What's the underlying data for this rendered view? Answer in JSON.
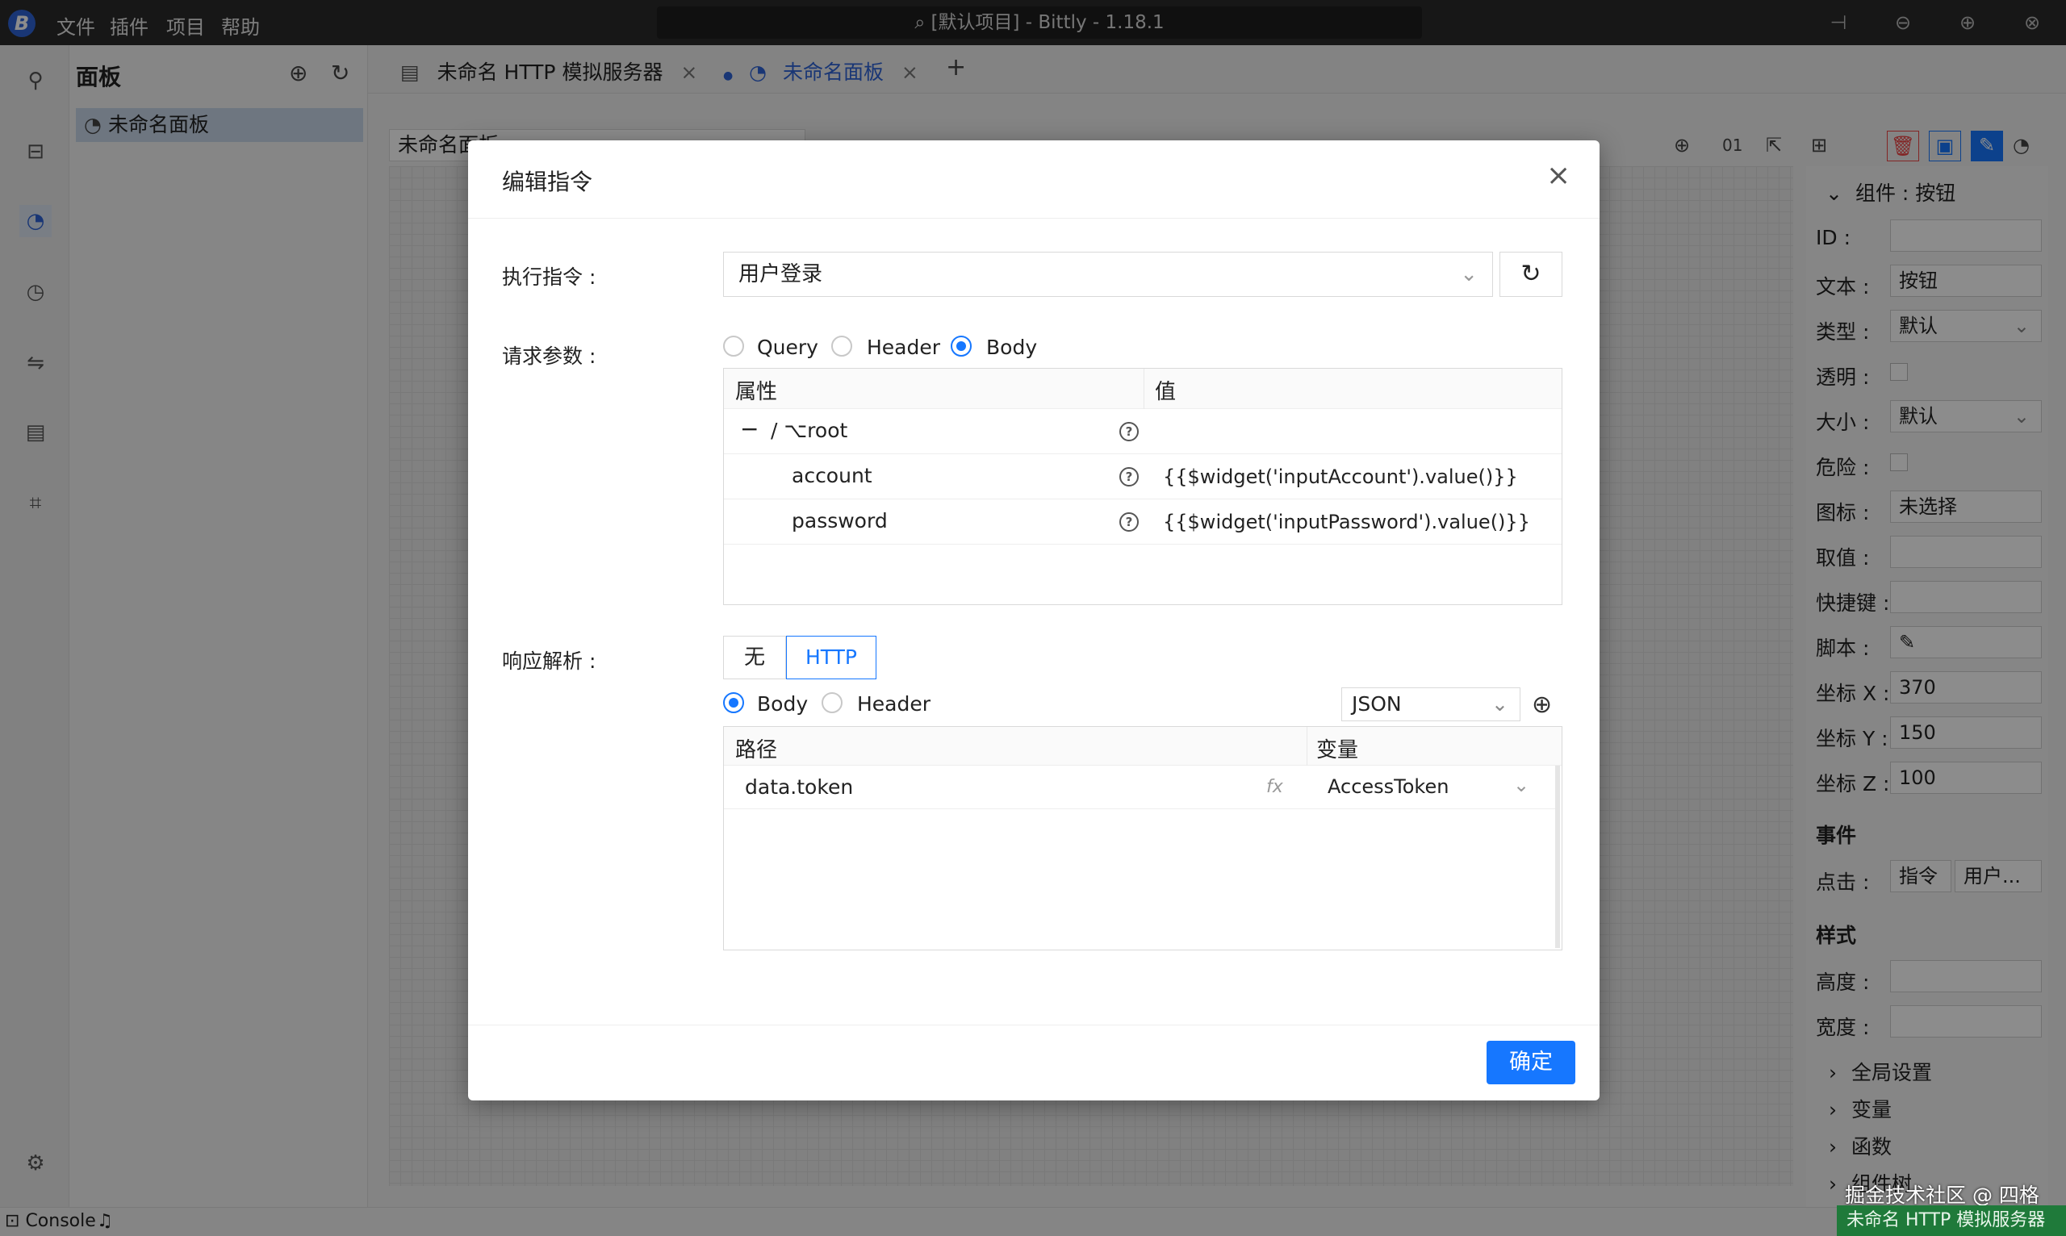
{
  "titlebar": {
    "menu": [
      "文件",
      "插件",
      "项目",
      "帮助"
    ],
    "search_text": "[默认项目] - Bittly - 1.18.1"
  },
  "sidebar": {
    "title": "面板",
    "items": [
      {
        "label": "未命名面板"
      }
    ]
  },
  "tabs": [
    {
      "label": "未命名 HTTP 模拟服务器"
    },
    {
      "label": "未命名面板"
    }
  ],
  "canvas": {
    "panel_name": "未命名面板"
  },
  "toolbar": {
    "code_btn": "01"
  },
  "props": {
    "section": "组件 : 按钮",
    "fields": {
      "id_label": "ID :",
      "id_value": "",
      "text_label": "文本 :",
      "text_value": "按钮",
      "type_label": "类型 :",
      "type_value": "默认",
      "transparent_label": "透明 :",
      "size_label": "大小 :",
      "size_value": "默认",
      "danger_label": "危险 :",
      "icon_label": "图标 :",
      "icon_value": "未选择",
      "value_label": "取值 :",
      "shortcut_label": "快捷键 :",
      "script_label": "脚本 :",
      "x_label": "坐标 X :",
      "x_value": "370",
      "y_label": "坐标 Y :",
      "y_value": "150",
      "z_label": "坐标 Z :",
      "z_value": "100"
    },
    "events_title": "事件",
    "click_label": "点击 :",
    "click_cmd": "指令",
    "click_user": "用户...",
    "style_title": "样式",
    "height_label": "高度 :",
    "width_label": "宽度 :",
    "collapsibles": [
      "全局设置",
      "变量",
      "函数",
      "组件树"
    ]
  },
  "modal": {
    "title": "编辑指令",
    "exec_label": "执行指令 :",
    "exec_value": "用户登录",
    "params_label": "请求参数 :",
    "param_modes": [
      "Query",
      "Header",
      "Body"
    ],
    "param_selected": "Body",
    "table_headers": [
      "属性",
      "值"
    ],
    "root_label": "/ ⌥root",
    "params": [
      {
        "name": "account",
        "value": "{{$widget('inputAccount').value()}}"
      },
      {
        "name": "password",
        "value": "{{$widget('inputPassword').value()}}"
      }
    ],
    "resp_label": "响应解析 :",
    "resp_modes": [
      "无",
      "HTTP"
    ],
    "resp_selected": "HTTP",
    "resp_sources": [
      "Body",
      "Header"
    ],
    "resp_source_selected": "Body",
    "format": "JSON",
    "map_headers": [
      "路径",
      "变量"
    ],
    "mappings": [
      {
        "path": "data.token",
        "fx": "fx",
        "variable": "AccessToken"
      }
    ],
    "ok_label": "确定"
  },
  "status": {
    "console": "Console",
    "server": "未命名 HTTP 模拟服务器",
    "watermark": "掘金技术社区 @ 四格"
  }
}
